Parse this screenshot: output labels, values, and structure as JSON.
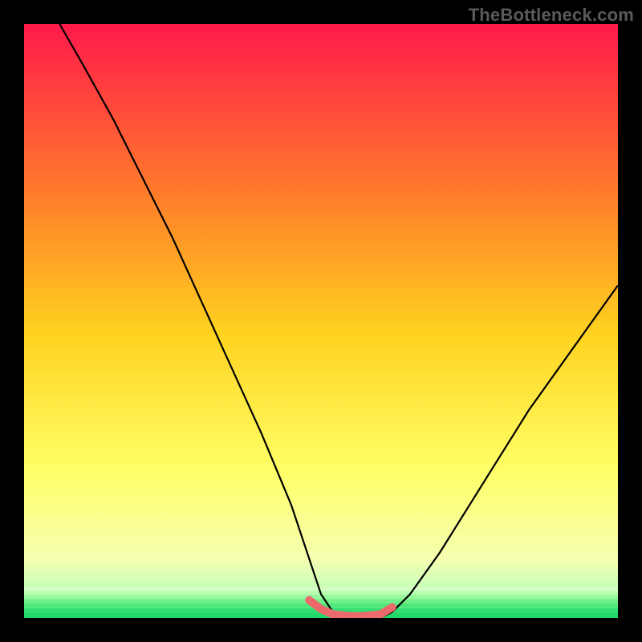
{
  "watermark": "TheBottleneck.com",
  "colors": {
    "background": "#000000",
    "watermark_text": "#5a5a5a",
    "curve": "#000000",
    "highlight": "#ed6a6c",
    "grad_top": "#ff1a4b",
    "grad_mid1": "#ff7a2a",
    "grad_mid2": "#ffd21f",
    "grad_mid3": "#ffff66",
    "grad_mid4": "#f5ffb0",
    "grad_bottom": "#22e06e"
  },
  "chart_data": {
    "type": "line",
    "title": "",
    "xlabel": "",
    "ylabel": "",
    "xlim": [
      0,
      100
    ],
    "ylim": [
      0,
      100
    ],
    "series": [
      {
        "name": "bottleneck-curve",
        "x": [
          6,
          10,
          15,
          20,
          25,
          30,
          35,
          40,
          45,
          48,
          50,
          52,
          55,
          57,
          60,
          62,
          65,
          70,
          75,
          80,
          85,
          90,
          95,
          100
        ],
        "y": [
          100,
          93,
          84,
          74,
          64,
          53,
          42,
          31,
          19,
          10,
          4,
          1,
          0,
          0,
          0,
          1,
          4,
          11,
          19,
          27,
          35,
          42,
          49,
          56
        ]
      },
      {
        "name": "highlight-bottom",
        "x": [
          48,
          50,
          52,
          55,
          57,
          60,
          62
        ],
        "y": [
          3,
          1.5,
          0.6,
          0.3,
          0.3,
          0.6,
          1.8
        ]
      }
    ],
    "gradient_stops_pct": [
      0,
      28,
      52,
      75,
      90,
      95,
      100
    ]
  }
}
